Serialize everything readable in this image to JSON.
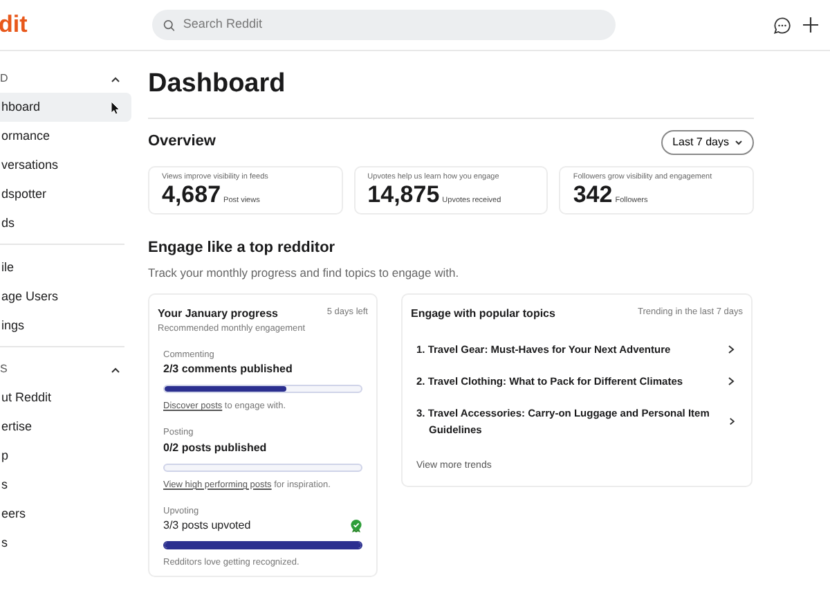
{
  "header": {
    "logo": "dit",
    "search": {
      "placeholder": "Search Reddit"
    }
  },
  "sidebar": {
    "sections": [
      {
        "title": "D",
        "expanded": true,
        "items": [
          {
            "label": "hboard",
            "selected": true
          },
          {
            "label": "ormance",
            "selected": false
          },
          {
            "label": "versations",
            "selected": false
          },
          {
            "label": "dspotter",
            "selected": false
          },
          {
            "label": "ds",
            "selected": false
          }
        ]
      },
      {
        "items": [
          {
            "label": "ile",
            "selected": false
          },
          {
            "label": "age Users",
            "selected": false
          },
          {
            "label": "ings",
            "selected": false
          }
        ]
      },
      {
        "title": "S",
        "expanded": true,
        "items": [
          {
            "label": "ut Reddit",
            "selected": false
          },
          {
            "label": "ertise",
            "selected": false
          },
          {
            "label": "p",
            "selected": false
          },
          {
            "label": "s",
            "selected": false
          },
          {
            "label": "eers",
            "selected": false
          },
          {
            "label": "s",
            "selected": false
          }
        ]
      }
    ]
  },
  "page_title": "Dashboard",
  "overview": {
    "title": "Overview",
    "range": "Last 7 days",
    "stats": [
      {
        "caption": "Views improve visibility in feeds",
        "value": "4,687",
        "unit": "Post views"
      },
      {
        "caption": "Upvotes help us learn how you engage",
        "value": "14,875",
        "unit": "Upvotes received"
      },
      {
        "caption": "Followers grow visibility and engagement",
        "value": "342",
        "unit": "Followers"
      }
    ]
  },
  "engage": {
    "title": "Engage like a top redditor",
    "subtitle": "Track your monthly progress and find topics to engage with.",
    "progress": {
      "title": "Your January progress",
      "remaining": "5 days left",
      "subtitle": "Recommended monthly engagement",
      "goals": [
        {
          "category": "Commenting",
          "status": "2/3 comments published",
          "complete": false,
          "level": 0.62,
          "link": "Discover posts",
          "hint": " to engage with."
        },
        {
          "category": "Posting",
          "status": "0/2 posts published",
          "complete": false,
          "level": 0,
          "link": "View high performing posts",
          "hint": " for inspiration."
        },
        {
          "category": "Upvoting",
          "status": "3/3 posts upvoted",
          "complete": true,
          "level": 1,
          "hint": "Redditors love getting recognized."
        }
      ]
    },
    "topics": {
      "title": "Engage with popular topics",
      "note": "Trending in the last 7 days",
      "items": [
        "1. Travel Gear: Must-Haves for Your Next Adventure",
        "2. Travel Clothing: What to Pack for Different Climates",
        "3. Travel Accessories: Carry-on Luggage and Personal Item Guidelines"
      ],
      "more": "View more trends"
    }
  }
}
